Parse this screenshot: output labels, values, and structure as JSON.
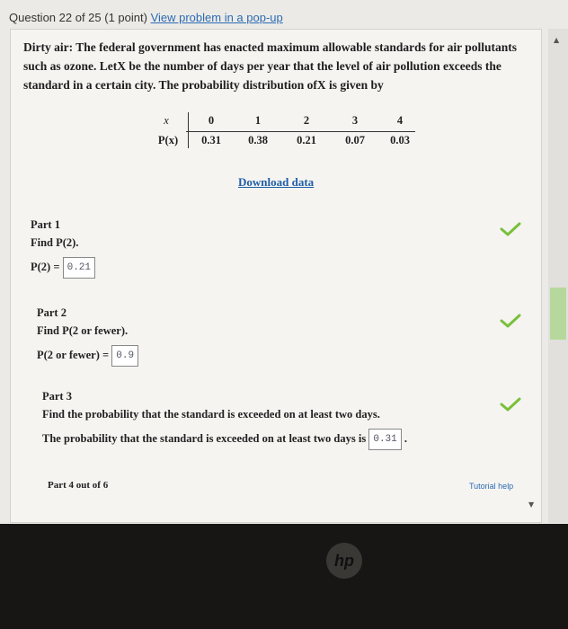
{
  "header": {
    "question_status": "Question 22 of 25 (1 point)",
    "popup_link": "View problem in a pop-up"
  },
  "problem": {
    "intro": "Dirty air: The federal government has enacted maximum allowable standards for air pollutants such as ozone. LetX be the number of days per year that the level of air pollution exceeds the standard in a certain city. The probability distribution ofX is given by"
  },
  "table": {
    "x_label": "x",
    "p_label": "P(x)",
    "x_values": [
      "0",
      "1",
      "2",
      "3",
      "4"
    ],
    "p_values": [
      "0.31",
      "0.38",
      "0.21",
      "0.07",
      "0.03"
    ]
  },
  "download_label": "Download data",
  "parts": [
    {
      "title": "Part 1",
      "prompt": "Find P(2).",
      "answer_label": "P(2) =",
      "answer": "0.21",
      "suffix": ""
    },
    {
      "title": "Part 2",
      "prompt": "Find P(2 or fewer).",
      "answer_label": "P(2 or fewer) =",
      "answer": "0.9",
      "suffix": ""
    },
    {
      "title": "Part 3",
      "prompt": "Find the probability that the standard is exceeded on at least two days.",
      "answer_label": "The probability that the standard is exceeded on at least two days is",
      "answer": "0.31",
      "suffix": "."
    },
    {
      "title": "Part 4 out of 6"
    }
  ],
  "tutorial_label": "Tutorial help",
  "brand": "hp",
  "colors": {
    "check": "#79c03a",
    "link": "#2a6bb5",
    "scroll_thumb": "#b6d89c"
  },
  "icons": [
    "checkmark-icon",
    "scroll-up-arrow-icon",
    "scroll-down-arrow-icon"
  ]
}
